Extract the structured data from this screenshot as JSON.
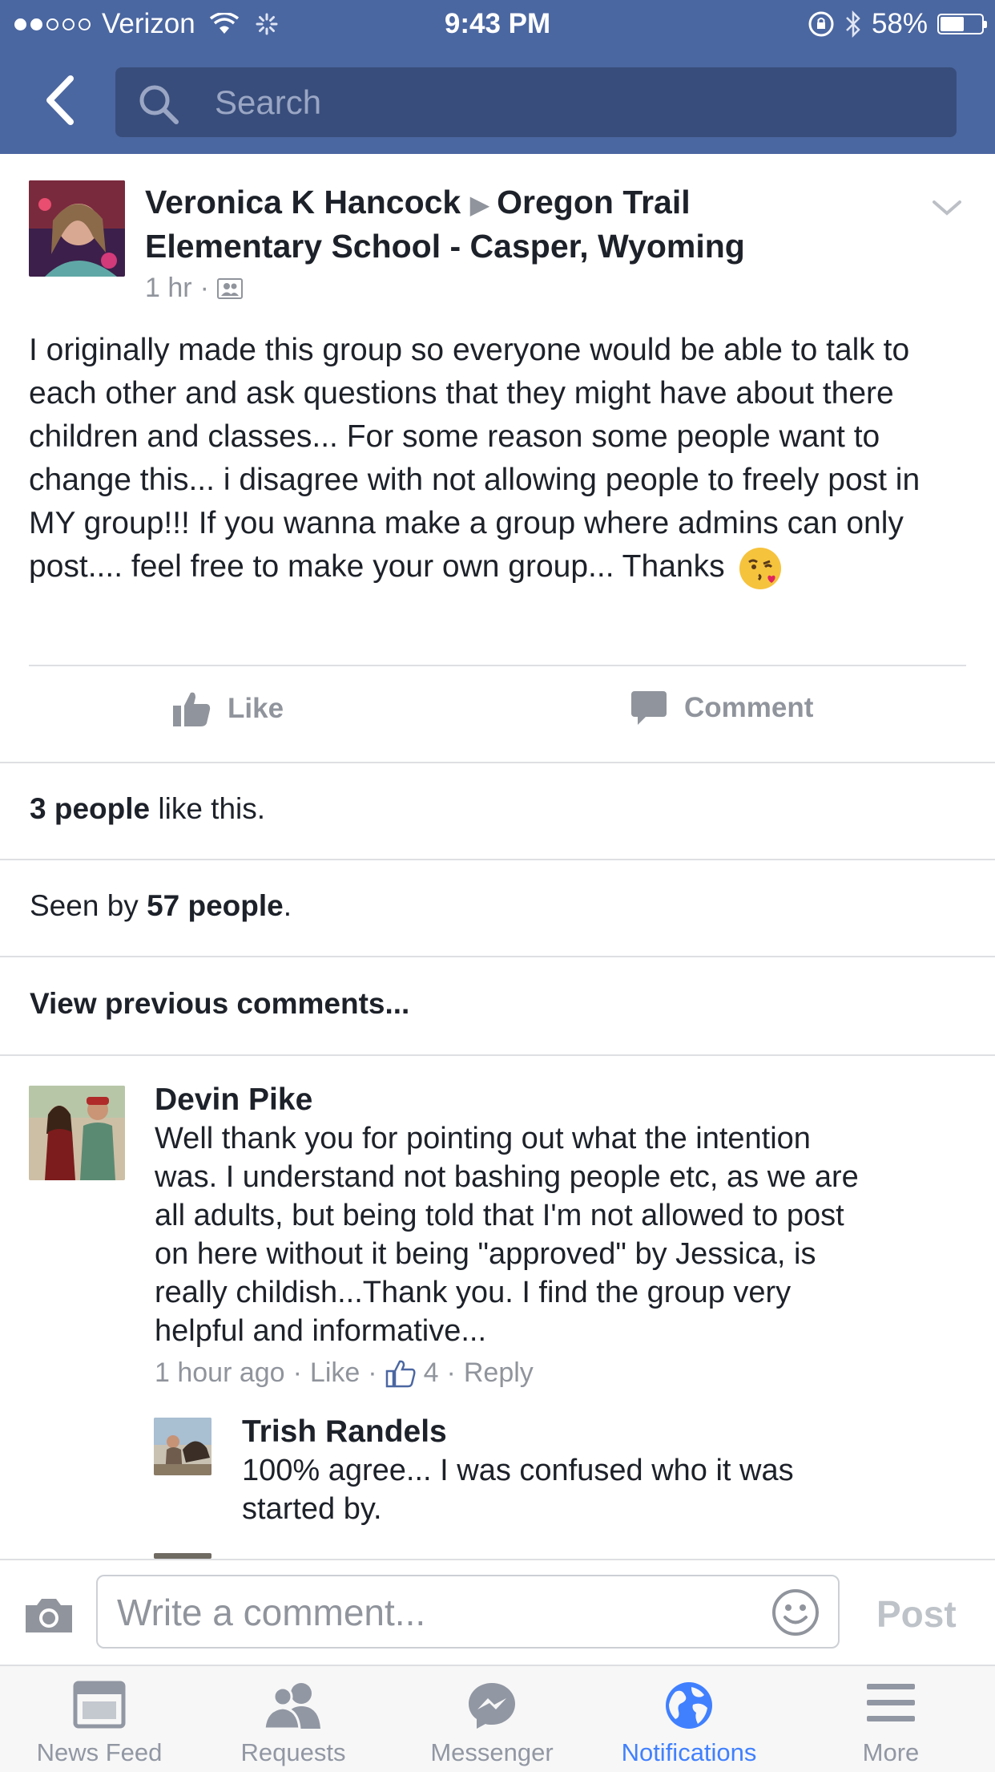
{
  "status_bar": {
    "carrier": "Verizon",
    "time": "9:43 PM",
    "battery": "58%",
    "battery_level": 0.58
  },
  "nav": {
    "search_placeholder": "Search"
  },
  "post": {
    "author": "Veronica K Hancock",
    "group": "Oregon Trail",
    "group_line2": "Elementary School - Casper, Wyoming",
    "time": "1 hr",
    "audience_icon": "group-icon",
    "body": "I originally made this group so everyone would be able to talk to each other and ask questions that they might have about there children and classes... For some reason some people want to change this... i disagree with not allowing people to freely post in MY group!!! If you wanna make a group where admins can only post.... feel free to make your own group... Thanks",
    "like_label": "Like",
    "comment_label": "Comment",
    "likes_count": "3 people",
    "likes_suffix": " like this.",
    "seen_prefix": "Seen by ",
    "seen_count": "57 people",
    "seen_suffix": ".",
    "view_previous": "View previous comments..."
  },
  "comments": [
    {
      "name": "Devin Pike",
      "lines": [
        "Well thank you for pointing out what the intention",
        "was. I understand not bashing people etc, as we are",
        "all adults, but being told that I'm not allowed to post",
        "on here without it being \"approved\" by Jessica, is",
        "really childish...Thank you. I find the group very",
        "helpful and informative..."
      ],
      "time": "1 hour ago",
      "like": "Like",
      "reactions": "4",
      "reply": "Reply"
    }
  ],
  "replies": [
    {
      "name": "Trish Randels",
      "lines": [
        "100% agree... I was confused who it was",
        "started by."
      ]
    }
  ],
  "composer": {
    "placeholder": "Write a comment...",
    "post_label": "Post"
  },
  "tabs": [
    {
      "label": "News Feed",
      "icon": "news-feed-icon"
    },
    {
      "label": "Requests",
      "icon": "friends-icon"
    },
    {
      "label": "Messenger",
      "icon": "messenger-icon"
    },
    {
      "label": "Notifications",
      "icon": "globe-icon",
      "active": true
    },
    {
      "label": "More",
      "icon": "menu-icon"
    }
  ],
  "colors": {
    "header": "#4b67a1",
    "search_field": "#384d7b",
    "active_tab": "#4080ff",
    "muted_text": "#90949c"
  }
}
